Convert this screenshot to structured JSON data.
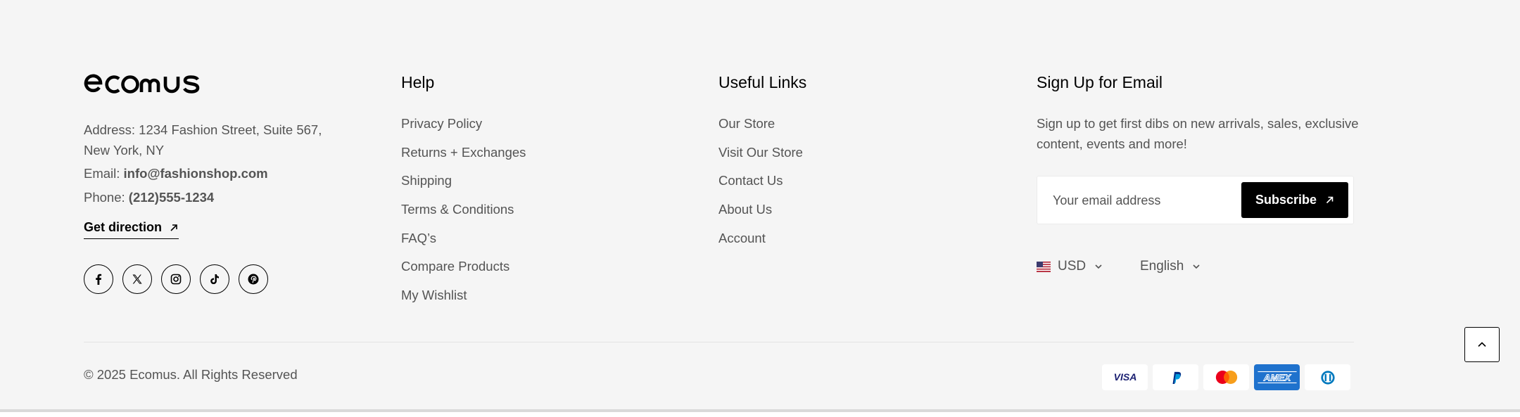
{
  "brand": {
    "logo_text": "ecomus"
  },
  "contact": {
    "address_label": "Address:",
    "address_value": "1234 Fashion Street, Suite 567, New York, NY",
    "email_label": "Email:",
    "email_value": "info@fashionshop.com",
    "phone_label": "Phone:",
    "phone_value": "(212)555-1234",
    "get_direction": "Get direction"
  },
  "socials": [
    {
      "icon": "facebook-icon"
    },
    {
      "icon": "x-twitter-icon"
    },
    {
      "icon": "instagram-icon"
    },
    {
      "icon": "tiktok-icon"
    },
    {
      "icon": "pinterest-icon"
    }
  ],
  "help": {
    "title": "Help",
    "links": [
      "Privacy Policy",
      "Returns + Exchanges",
      "Shipping",
      "Terms & Conditions",
      "FAQ’s",
      "Compare Products",
      "My Wishlist"
    ]
  },
  "useful_links": {
    "title": "Useful Links",
    "links": [
      "Our Store",
      "Visit Our Store",
      "Contact Us",
      "About Us",
      "Account"
    ]
  },
  "signup": {
    "title": "Sign Up for Email",
    "description": "Sign up to get first dibs on new arrivals, sales, exclusive content, events and more!",
    "email_placeholder": "Your email address",
    "subscribe_label": "Subscribe"
  },
  "currency": {
    "selected": "USD",
    "flag": "us-flag-icon"
  },
  "language": {
    "selected": "English"
  },
  "copyright": "© 2025 Ecomus. All Rights Reserved",
  "payments": [
    "Visa",
    "PayPal",
    "Mastercard",
    "American Express",
    "Diners Club"
  ],
  "colors": {
    "background": "#f5f5f5",
    "text": "#545454",
    "heading": "#000000",
    "button": "#000000",
    "amex": "#1f72cd"
  }
}
